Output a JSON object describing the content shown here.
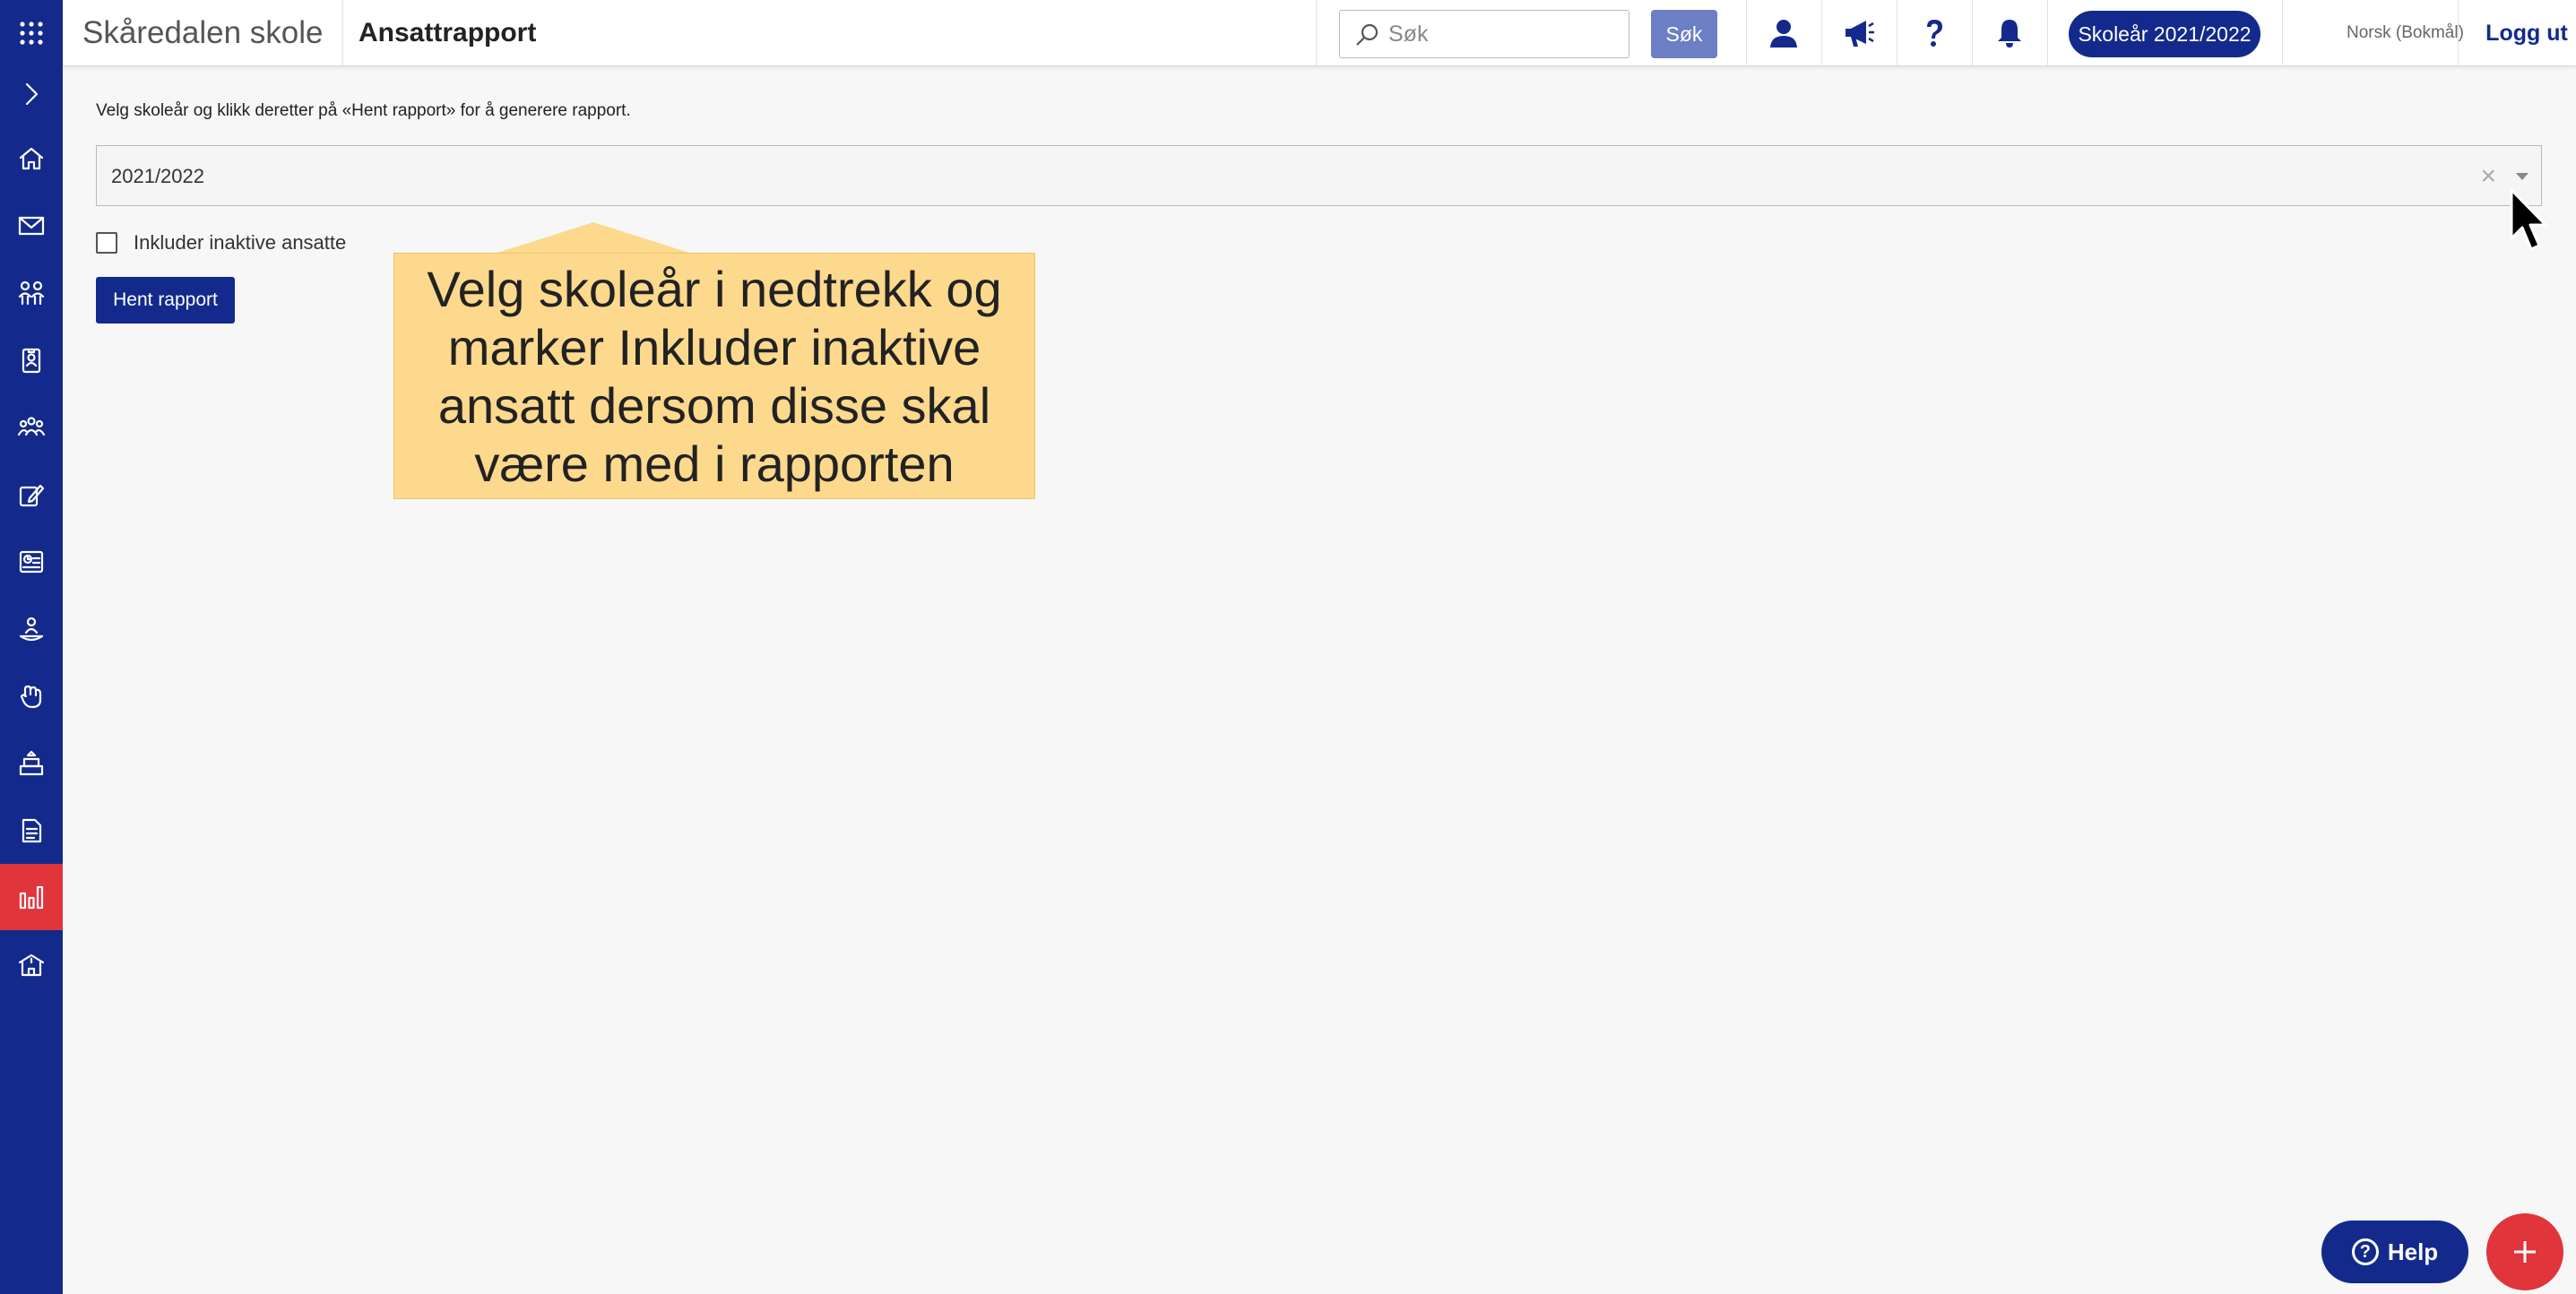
{
  "header": {
    "school_name": "Skåredalen skole",
    "page_title": "Ansattrapport",
    "search_placeholder": "Søk",
    "search_button": "Søk",
    "school_year_pill": "Skoleår 2021/2022",
    "language": "Norsk (Bokmål)",
    "logout": "Logg ut"
  },
  "sidebar": {
    "items": [
      {
        "icon": "apps-grid-icon"
      },
      {
        "icon": "chevron-right-icon"
      },
      {
        "icon": "home-icon"
      },
      {
        "icon": "mail-icon"
      },
      {
        "icon": "people-icon"
      },
      {
        "icon": "badge-icon"
      },
      {
        "icon": "groups-icon"
      },
      {
        "icon": "edit-document-icon"
      },
      {
        "icon": "schedule-icon"
      },
      {
        "icon": "person-support-icon"
      },
      {
        "icon": "hand-icon"
      },
      {
        "icon": "building-icon"
      },
      {
        "icon": "document-icon"
      },
      {
        "icon": "bar-chart-icon",
        "active": true
      },
      {
        "icon": "school-icon"
      }
    ]
  },
  "main": {
    "instruction": "Velg skoleår og klikk deretter på «Hent rapport» for å generere rapport.",
    "year_select_value": "2021/2022",
    "clear_symbol": "×",
    "include_inactive_label": "Inkluder inaktive ansatte",
    "include_inactive_checked": false,
    "fetch_button": "Hent rapport"
  },
  "callout": {
    "text": "Velg skoleår i nedtrekk og marker Inkluder inaktive ansatt dersom disse skal være med i rapporten"
  },
  "floating": {
    "help_label": "Help",
    "help_symbol": "?"
  },
  "colors": {
    "brand": "#132a8c",
    "accent": "#e0353b",
    "callout": "#fcd98d"
  }
}
